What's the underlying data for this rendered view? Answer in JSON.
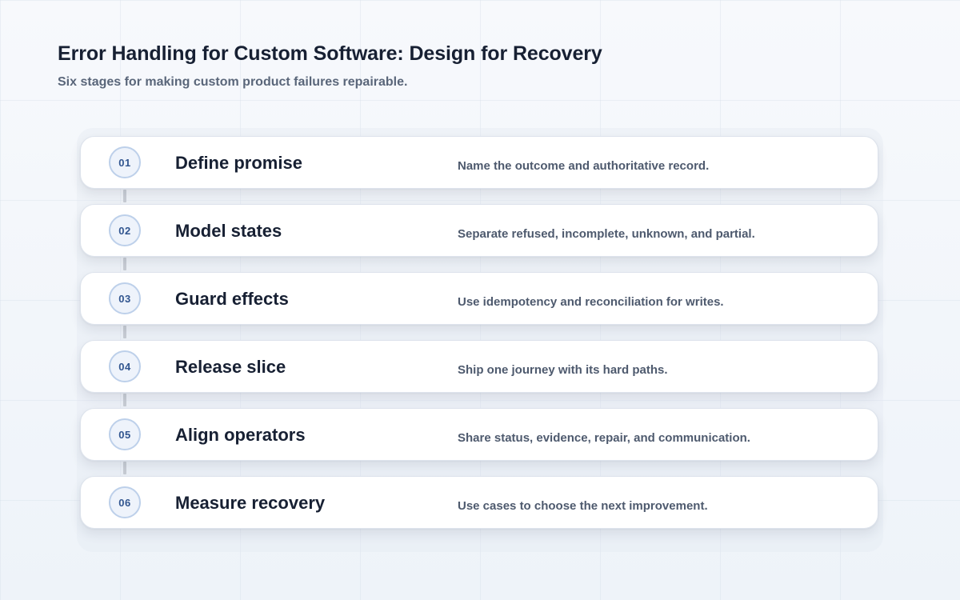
{
  "header": {
    "title": "Error Handling for Custom Software: Design for Recovery",
    "subtitle": "Six stages for making custom product failures repairable."
  },
  "stages": [
    {
      "number": "01",
      "title": "Define promise",
      "description": "Name the outcome and authoritative record."
    },
    {
      "number": "02",
      "title": "Model states",
      "description": "Separate refused, incomplete, unknown, and partial."
    },
    {
      "number": "03",
      "title": "Guard effects",
      "description": "Use idempotency and reconciliation for writes."
    },
    {
      "number": "04",
      "title": "Release slice",
      "description": "Ship one journey with its hard paths."
    },
    {
      "number": "05",
      "title": "Align operators",
      "description": "Share status, evidence, repair, and communication."
    },
    {
      "number": "06",
      "title": "Measure recovery",
      "description": "Use cases to choose the next improvement."
    }
  ],
  "colors": {
    "title_text": "#172033",
    "subtitle_text": "#5a667a",
    "badge_text": "#31558f",
    "badge_border": "#bdd0ea",
    "connector": "#c7ccd4",
    "card_background": "#ffffff"
  }
}
